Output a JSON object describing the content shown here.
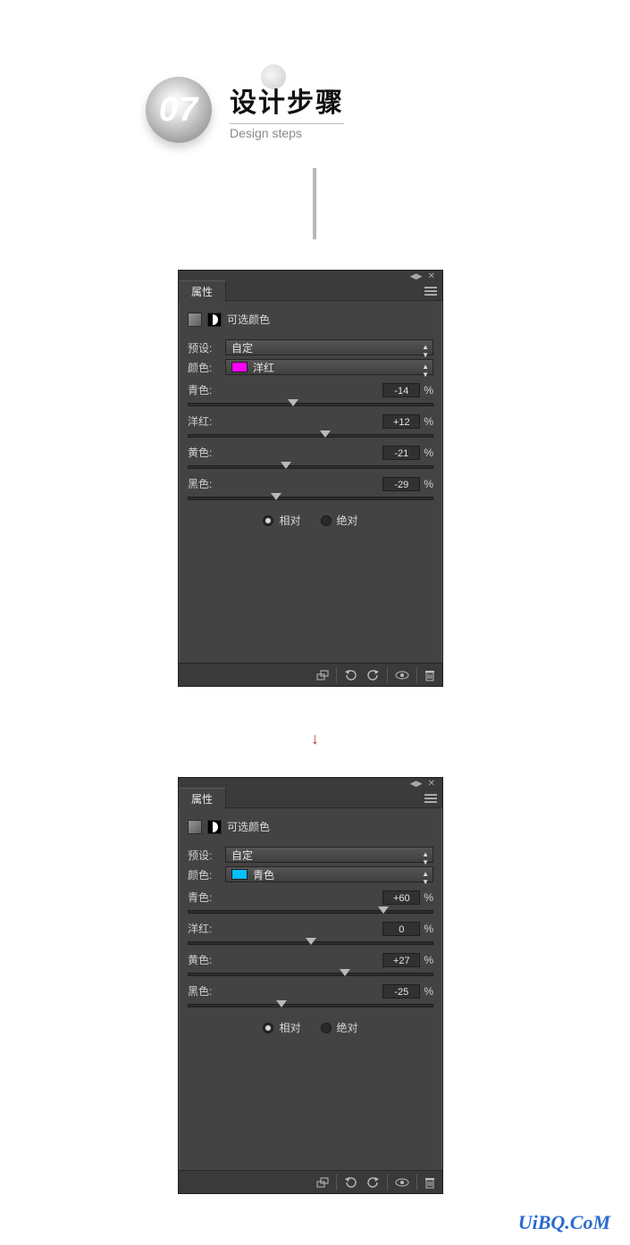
{
  "header": {
    "step_number": "07",
    "title_cn": "设计步骤",
    "title_en": "Design steps"
  },
  "panel_common": {
    "tab_label": "属性",
    "adjustment_label": "可选颜色",
    "preset_label": "预设:",
    "preset_value": "自定",
    "color_label": "颜色:",
    "slider_labels": {
      "cyan": "青色:",
      "magenta": "洋红:",
      "yellow": "黄色:",
      "black": "黑色:"
    },
    "radio_relative": "相对",
    "radio_absolute": "绝对",
    "percent": "%"
  },
  "panel1": {
    "color_value": "洋红",
    "swatch_class": "swatch-magenta",
    "sliders": {
      "cyan": {
        "value": "-14",
        "pos": 0.43
      },
      "magenta": {
        "value": "+12",
        "pos": 0.56
      },
      "yellow": {
        "value": "-21",
        "pos": 0.4
      },
      "black": {
        "value": "-29",
        "pos": 0.36
      }
    }
  },
  "panel2": {
    "color_value": "青色",
    "swatch_class": "swatch-cyan",
    "sliders": {
      "cyan": {
        "value": "+60",
        "pos": 0.8
      },
      "magenta": {
        "value": "0",
        "pos": 0.5
      },
      "yellow": {
        "value": "+27",
        "pos": 0.64
      },
      "black": {
        "value": "-25",
        "pos": 0.38
      }
    }
  },
  "watermark": "UiBQ.CoM"
}
